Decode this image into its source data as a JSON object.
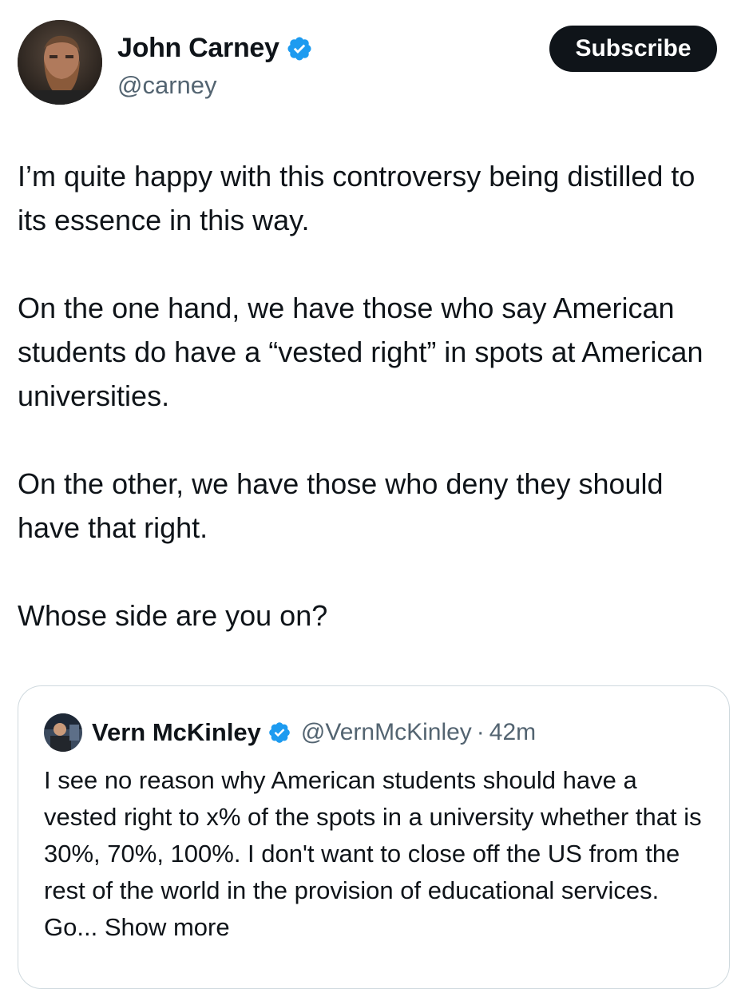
{
  "author": {
    "name": "John Carney",
    "handle": "@carney",
    "verified_icon": "verified-badge-icon",
    "verified_color": "#1d9bf0"
  },
  "subscribe_label": "Subscribe",
  "tweet": {
    "paragraphs": [
      "I’m quite happy with this controversy being distilled to its essence in this way.",
      "On the one hand, we have those who say American students do have a “vested right” in spots at American universities.",
      "On the other, we have those who deny they should have that right.",
      "Whose side are you on?"
    ]
  },
  "quote": {
    "name": "Vern McKinley",
    "handle": "@VernMcKinley",
    "separator": "·",
    "time": "42m",
    "text": "I see no reason why American students should have a vested right to x% of the spots in a university whether that is 30%, 70%, 100%. I don't want to close off the US from the rest of the world in the provision of educational services. Go...",
    "show_more": "Show more"
  }
}
